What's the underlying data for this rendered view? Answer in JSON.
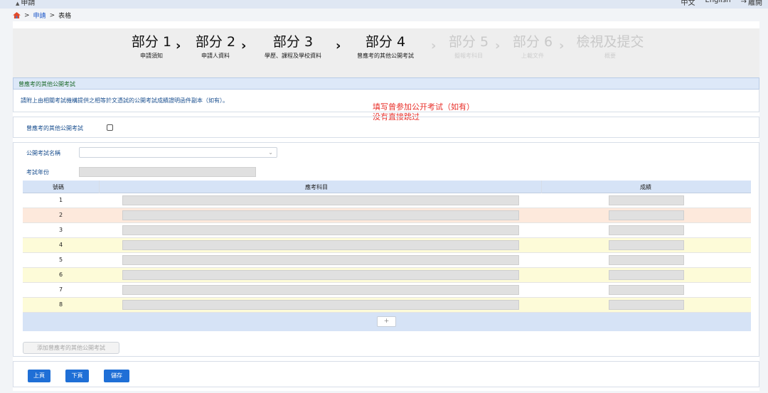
{
  "topbar": {
    "app_title": "申請",
    "lang_zh": "中文",
    "lang_en": "English",
    "logout": "離開"
  },
  "breadcrumb": {
    "home_icon": "home-icon",
    "sep": ">",
    "link": "申請",
    "current": "表格"
  },
  "steps": [
    {
      "title": "部分 1",
      "sub": "申請須知",
      "enabled": true
    },
    {
      "title": "部分 2",
      "sub": "申請人資料",
      "enabled": true
    },
    {
      "title": "部分 3",
      "sub": "學歷、課程及學校資料",
      "enabled": true
    },
    {
      "title": "部分 4",
      "sub": "曾應考的其他公開考試",
      "enabled": true
    },
    {
      "title": "部分 5",
      "sub": "擬報考科目",
      "enabled": false
    },
    {
      "title": "部分 6",
      "sub": "上載文件",
      "enabled": false
    },
    {
      "title": "檢視及提交",
      "sub": "概要",
      "enabled": false
    }
  ],
  "section": {
    "title": "曾應考的其他公開考試",
    "note": "請附上由相關考試機構提供之相等於文憑試的公開考試成績證明函件副本（如有）。",
    "annotation_line1": "填写曾参加公开考试（如有）",
    "annotation_line2": "没有直接跳过",
    "checkbox_label": "曾應考的其他公開考試",
    "exam_name_label": "公開考試名稱",
    "exam_year_label": "考試年份"
  },
  "table": {
    "col_num": "號碼",
    "col_subject": "應考科目",
    "col_grade": "成績",
    "rows": [
      "1",
      "2",
      "3",
      "4",
      "5",
      "6",
      "7",
      "8"
    ],
    "add_symbol": "+"
  },
  "buttons": {
    "add_exam": "添加曾應考的其他公開考試",
    "prev": "上頁",
    "next": "下頁",
    "save": "儲存"
  },
  "colors": {
    "primary": "#1f6fd6",
    "annotation": "#e8302a"
  }
}
